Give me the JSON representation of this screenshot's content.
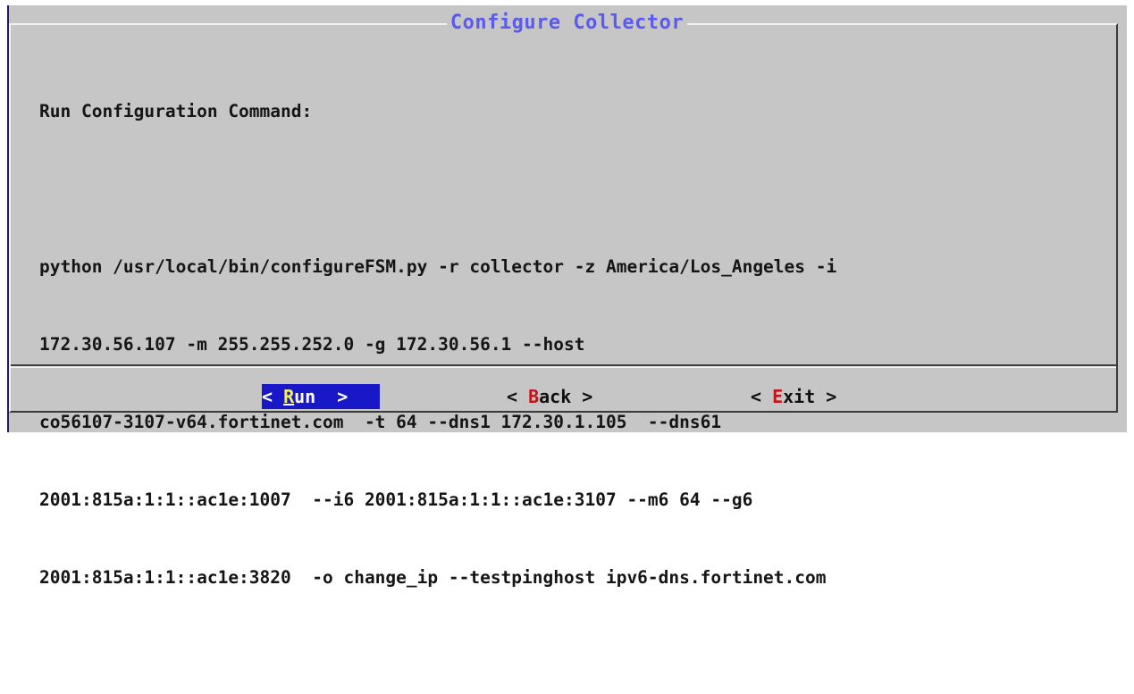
{
  "dialog": {
    "title": "Configure Collector",
    "heading": "Run Configuration Command:",
    "command_lines": [
      "python /usr/local/bin/configureFSM.py -r collector -z America/Los_Angeles -i",
      "172.30.56.107 -m 255.255.252.0 -g 172.30.56.1 --host",
      "co56107-3107-v64.fortinet.com  -t 64 --dns1 172.30.1.105  --dns61",
      "2001:815a:1:1::ac1e:1007  --i6 2001:815a:1:1::ac1e:3107 --m6 64 --g6",
      "2001:815a:1:1::ac1e:3820  -o change_ip --testpinghost ipv6-dns.fortinet.com"
    ]
  },
  "buttons": {
    "run": {
      "prefix": "< ",
      "hotkey": "R",
      "rest": "un  >"
    },
    "back": {
      "prefix": "< ",
      "hotkey": "B",
      "rest": "ack >"
    },
    "exit": {
      "prefix": "< ",
      "hotkey": "E",
      "rest": "xit >"
    }
  },
  "colors": {
    "dialog_bg": "#c6c6c6",
    "title": "#5a5af0",
    "selected_button_bg": "#1818c8",
    "hotkey": "#c0141a",
    "selected_hotkey": "#f5f05a"
  }
}
